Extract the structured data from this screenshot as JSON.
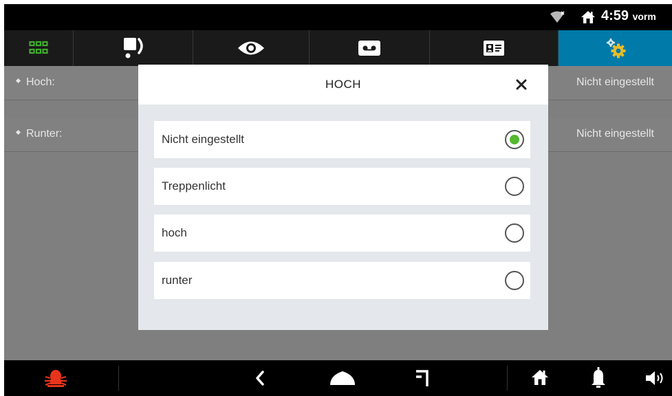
{
  "status_bar": {
    "time": "4:59",
    "ampm": "vorm"
  },
  "tabs": [
    {
      "icon": "grid-icon",
      "active": false
    },
    {
      "icon": "intercom-phone-icon",
      "active": false
    },
    {
      "icon": "eye-icon",
      "active": false
    },
    {
      "icon": "voicemail-icon",
      "active": false
    },
    {
      "icon": "contact-card-icon",
      "active": false
    },
    {
      "icon": "settings-gears-icon",
      "active": true
    }
  ],
  "rows": [
    {
      "label": "Hoch:",
      "value": "Nicht eingestellt"
    },
    {
      "label": "Runter:",
      "value": "Nicht eingestellt"
    }
  ],
  "dialog": {
    "title": "HOCH",
    "options": [
      {
        "label": "Nicht eingestellt",
        "selected": true
      },
      {
        "label": "Treppenlicht",
        "selected": false
      },
      {
        "label": "hoch",
        "selected": false
      },
      {
        "label": "runter",
        "selected": false
      }
    ]
  },
  "colors": {
    "accent": "#007aa8",
    "radio_selected": "#54b830",
    "alarm": "#e8341c",
    "grid_icon": "#3fae2a"
  },
  "navbar": {
    "icons": [
      "alarm-bug-icon",
      "back-icon",
      "home-icon",
      "recent-apps-icon",
      "house-icon",
      "bell-icon",
      "speaker-icon"
    ]
  }
}
